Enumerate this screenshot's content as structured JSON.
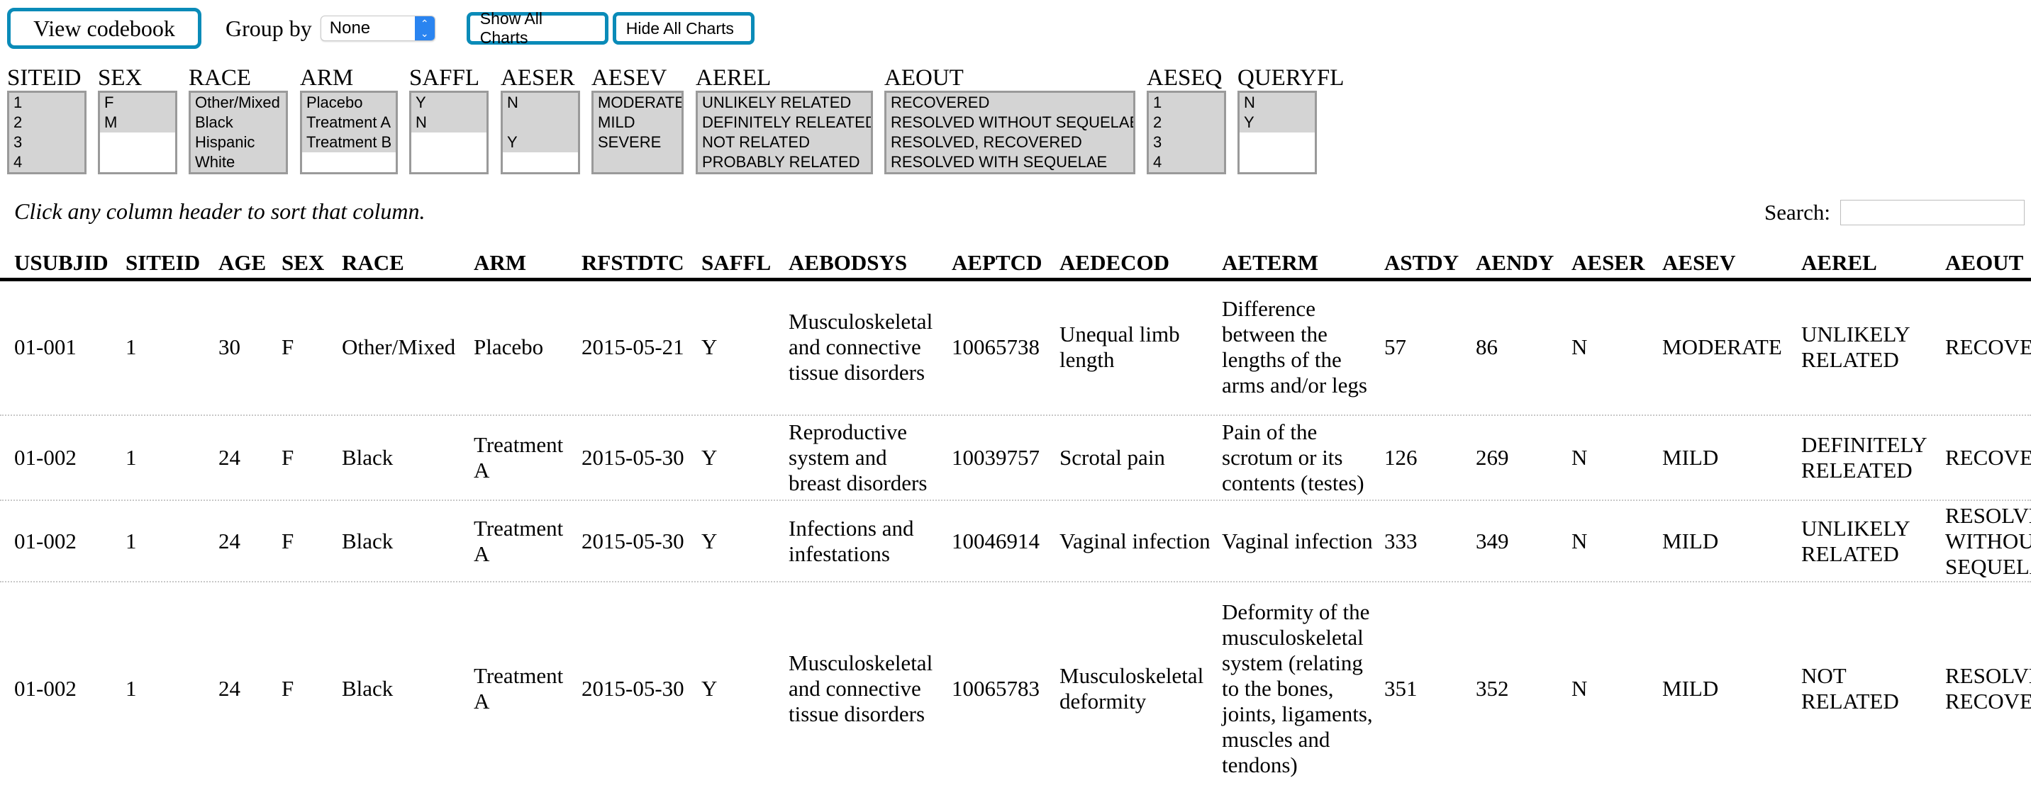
{
  "toolbar": {
    "view_codebook": "View codebook",
    "group_by_label": "Group by",
    "group_by_value": "None",
    "show_all_charts": "Show All Charts",
    "hide_all_charts": "Hide All Charts"
  },
  "filters": [
    {
      "label": "SITEID",
      "options": [
        {
          "text": "1",
          "selected": true
        },
        {
          "text": "2",
          "selected": true
        },
        {
          "text": "3",
          "selected": true
        },
        {
          "text": "4",
          "selected": true
        }
      ]
    },
    {
      "label": "SEX",
      "options": [
        {
          "text": "F",
          "selected": true
        },
        {
          "text": "M",
          "selected": true
        }
      ]
    },
    {
      "label": "RACE",
      "options": [
        {
          "text": "Other/Mixed",
          "selected": true
        },
        {
          "text": "Black",
          "selected": true
        },
        {
          "text": "Hispanic",
          "selected": true
        },
        {
          "text": "White",
          "selected": true
        }
      ]
    },
    {
      "label": "ARM",
      "options": [
        {
          "text": "Placebo",
          "selected": true
        },
        {
          "text": "Treatment A",
          "selected": true
        },
        {
          "text": "Treatment B",
          "selected": true
        }
      ]
    },
    {
      "label": "SAFFL",
      "options": [
        {
          "text": "Y",
          "selected": true
        },
        {
          "text": "N",
          "selected": true
        }
      ]
    },
    {
      "label": "AESER",
      "options": [
        {
          "text": "N",
          "selected": true
        },
        {
          "text": "",
          "selected": true
        },
        {
          "text": "Y",
          "selected": true
        }
      ]
    },
    {
      "label": "AESEV",
      "options": [
        {
          "text": "MODERATE",
          "selected": true
        },
        {
          "text": "MILD",
          "selected": true
        },
        {
          "text": "SEVERE",
          "selected": true
        },
        {
          "text": "",
          "selected": true
        }
      ]
    },
    {
      "label": "AEREL",
      "options": [
        {
          "text": "UNLIKELY RELATED",
          "selected": true
        },
        {
          "text": "DEFINITELY RELEATED",
          "selected": true
        },
        {
          "text": "NOT RELATED",
          "selected": true
        },
        {
          "text": "PROBABLY RELATED",
          "selected": true
        }
      ]
    },
    {
      "label": "AEOUT",
      "options": [
        {
          "text": "RECOVERED",
          "selected": true
        },
        {
          "text": "RESOLVED WITHOUT SEQUELAE",
          "selected": true
        },
        {
          "text": "RESOLVED, RECOVERED",
          "selected": true
        },
        {
          "text": "RESOLVED WITH SEQUELAE",
          "selected": true
        }
      ]
    },
    {
      "label": "AESEQ",
      "options": [
        {
          "text": "1",
          "selected": true
        },
        {
          "text": "2",
          "selected": true
        },
        {
          "text": "3",
          "selected": true
        },
        {
          "text": "4",
          "selected": true
        }
      ]
    },
    {
      "label": "QUERYFL",
      "options": [
        {
          "text": "N",
          "selected": true
        },
        {
          "text": "Y",
          "selected": true
        }
      ]
    }
  ],
  "sort_hint": "Click any column header to sort that column.",
  "search": {
    "label": "Search:",
    "value": ""
  },
  "table": {
    "columns": [
      "USUBJID",
      "SITEID",
      "AGE",
      "SEX",
      "RACE",
      "ARM",
      "RFSTDTC",
      "SAFFL",
      "AEBODSYS",
      "AEPTCD",
      "AEDECOD",
      "AETERM",
      "ASTDY",
      "AENDY",
      "AESER",
      "AESEV",
      "AEREL",
      "AEOUT"
    ],
    "rows": [
      [
        "01-001",
        "1",
        "30",
        "F",
        "Other/Mixed",
        "Placebo",
        "2015-05-21",
        "Y",
        "Musculoskeletal and connective tissue disorders",
        "10065738",
        "Unequal limb length",
        "Difference between the lengths of the arms and/or legs",
        "57",
        "86",
        "N",
        "MODERATE",
        "UNLIKELY RELATED",
        "RECOVERED"
      ],
      [
        "01-002",
        "1",
        "24",
        "F",
        "Black",
        "Treatment A",
        "2015-05-30",
        "Y",
        "Reproductive system and breast disorders",
        "10039757",
        "Scrotal pain",
        "Pain of the scrotum or its contents (testes)",
        "126",
        "269",
        "N",
        "MILD",
        "DEFINITELY RELEATED",
        "RECOVERED"
      ],
      [
        "01-002",
        "1",
        "24",
        "F",
        "Black",
        "Treatment A",
        "2015-05-30",
        "Y",
        "Infections and infestations",
        "10046914",
        "Vaginal infection",
        "Vaginal infection",
        "333",
        "349",
        "N",
        "MILD",
        "UNLIKELY RELATED",
        "RESOLVED WITHOUT SEQUELAE"
      ],
      [
        "01-002",
        "1",
        "24",
        "F",
        "Black",
        "Treatment A",
        "2015-05-30",
        "Y",
        "Musculoskeletal and connective tissue disorders",
        "10065783",
        "Musculoskeletal deformity",
        "Deformity of the musculoskeletal system (relating to the bones, joints, ligaments, muscles and tendons)",
        "351",
        "352",
        "N",
        "MILD",
        "NOT RELATED",
        "RESOLVED, RECOVERED"
      ]
    ]
  }
}
